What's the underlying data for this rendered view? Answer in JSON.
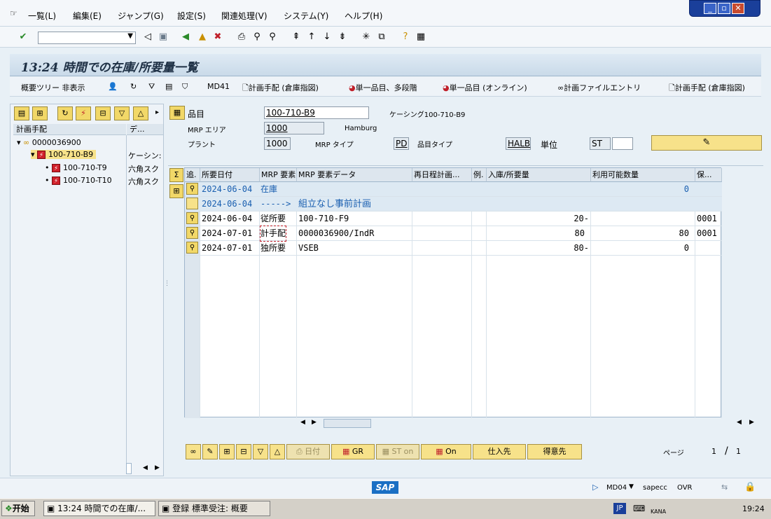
{
  "menu": [
    "一覧(L)",
    "編集(E)",
    "ジャンプ(G)",
    "設定(S)",
    "関連処理(V)",
    "システム(Y)",
    "ヘルプ(H)"
  ],
  "window_controls": [
    "_",
    "▫",
    "✕"
  ],
  "screen_title": "13:24 時間での在庫/所要量一覧",
  "app_toolbar": {
    "hide_tree": "概要ツリー 非表示",
    "md41": "MD41",
    "plan_manual_1": "計画手配 (倉庫指図)",
    "single_multi": "単一品目、多段階",
    "single_online": "単一品目 (オンライン)",
    "plan_file": "計画ファイルエントリ",
    "plan_manual_2": "計画手配 (倉庫指図)"
  },
  "tree": {
    "col1": "計画手配",
    "col2": "デ...",
    "root": "0000036900",
    "node": "100-710-B9",
    "node_desc": "ケーシン:",
    "children": [
      {
        "id": "100-710-T9",
        "desc": "六角スク"
      },
      {
        "id": "100-710-T10",
        "desc": "六角スク"
      }
    ]
  },
  "header": {
    "material_label": "品目",
    "material": "100-710-B9",
    "material_desc": "ケーシング100-710-B9",
    "mrp_area_label": "MRP エリア",
    "mrp_area": "1000",
    "mrp_area_desc": "Hamburg",
    "plant_label": "プラント",
    "plant": "1000",
    "mrp_type_label": "MRP タイプ",
    "mrp_type": "PD",
    "mat_type_label": "品目タイプ",
    "mat_type": "HALB",
    "unit_label": "単位",
    "unit": "ST"
  },
  "grid": {
    "columns": [
      "追.",
      "所要日付",
      "MRP 要素",
      "MRP 要素データ",
      "再日程計画...",
      "例.",
      "入庫/所要量",
      "利用可能数量",
      "保..."
    ],
    "rows": [
      {
        "date": "2024-06-04",
        "elem": "在庫",
        "data": "",
        "qty": "",
        "avail": "0",
        "stor": "",
        "blue": true,
        "icon": true
      },
      {
        "date": "2024-06-04",
        "elem": "----->",
        "data": "組立なし事前計画",
        "qty": "",
        "avail": "",
        "stor": "",
        "blue": true,
        "icon": false
      },
      {
        "date": "2024-06-04",
        "elem": "従所要",
        "data": "100-710-F9",
        "qty": "20-",
        "avail": "",
        "stor": "0001",
        "blue": false,
        "icon": true
      },
      {
        "date": "2024-07-01",
        "elem": "計手配",
        "data": "0000036900/IndR",
        "qty": "80",
        "avail": "80",
        "stor": "0001",
        "blue": false,
        "icon": true
      },
      {
        "date": "2024-07-01",
        "elem": "独所要",
        "data": "VSEB",
        "qty": "80-",
        "avail": "0",
        "stor": "",
        "blue": false,
        "icon": true
      }
    ]
  },
  "bottom_buttons": {
    "date": "日付",
    "gr": "GR",
    "st_on": "ST on",
    "on": "On",
    "vendor": "仕入先",
    "customer": "得意先"
  },
  "paging": {
    "label": "ページ",
    "current": "1",
    "sep": "/",
    "total": "1"
  },
  "status": {
    "sap": "SAP",
    "tcode": "MD04",
    "server": "sapecc",
    "mode": "OVR"
  },
  "taskbar": {
    "start": "开始",
    "task1": "13:24 時間での在庫/...",
    "task2": "登録 標準受注: 概要",
    "ime": "JP",
    "kana": "KANA",
    "clock": "19:24"
  }
}
